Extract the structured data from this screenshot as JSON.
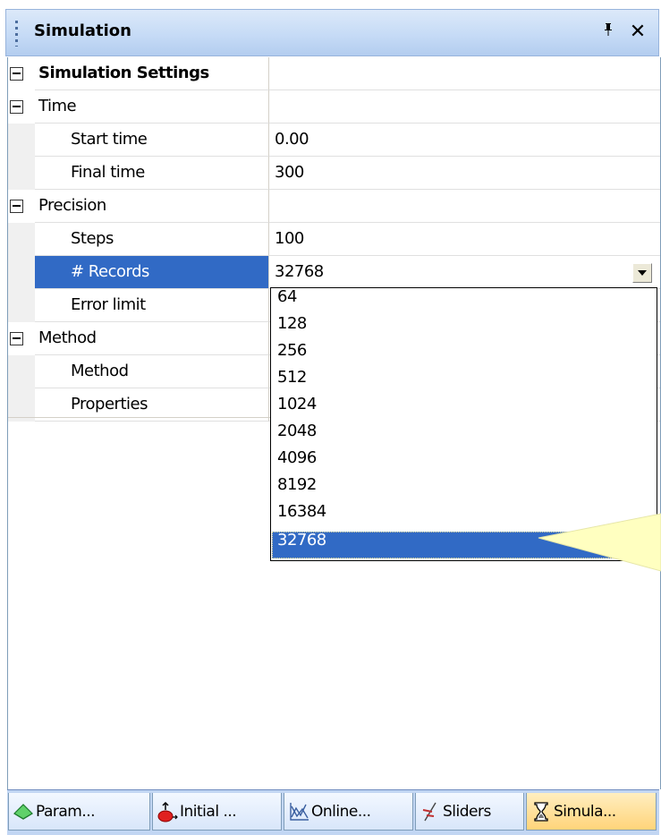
{
  "panel": {
    "title": "Simulation",
    "pin_glyph": "⩞",
    "close_glyph": "✕"
  },
  "grid": {
    "rows": [
      {
        "type": "title",
        "label": "Simulation Settings",
        "value": ""
      },
      {
        "type": "category",
        "label": "Time",
        "value": ""
      },
      {
        "type": "property",
        "label": "Start time",
        "value": "0.00"
      },
      {
        "type": "property",
        "label": "Final time",
        "value": "300"
      },
      {
        "type": "category",
        "label": "Precision",
        "value": ""
      },
      {
        "type": "property",
        "label": "Steps",
        "value": "100"
      },
      {
        "type": "property",
        "label": "# Records",
        "value": "32768",
        "selected": true
      },
      {
        "type": "property",
        "label": "Error limit",
        "value": ""
      },
      {
        "type": "category",
        "label": "Method",
        "value": ""
      },
      {
        "type": "property",
        "label": "Method",
        "value": ""
      },
      {
        "type": "property",
        "label": "Properties",
        "value": ""
      }
    ]
  },
  "dropdown": {
    "selected": "32768",
    "options": [
      "64",
      "128",
      "256",
      "512",
      "1024",
      "2048",
      "4096",
      "8192",
      "16384",
      "32768"
    ]
  },
  "tabs": [
    {
      "label": "Param...",
      "icon": "flask-icon"
    },
    {
      "label": "Initial ...",
      "icon": "initial-values-icon"
    },
    {
      "label": "Online...",
      "icon": "chart-icon"
    },
    {
      "label": "Sliders",
      "icon": "sliders-icon"
    },
    {
      "label": "Simula...",
      "icon": "hourglass-icon",
      "active": true
    }
  ],
  "colors": {
    "selection": "#316ac5",
    "callout": "#ffffc0",
    "active_tab": "#ffd47a"
  }
}
